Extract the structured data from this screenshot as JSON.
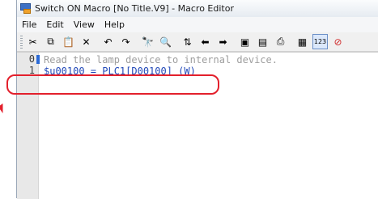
{
  "window": {
    "title": "Switch ON Macro [No Title.V9] - Macro Editor"
  },
  "menu": [
    {
      "label": "File"
    },
    {
      "label": "Edit"
    },
    {
      "label": "View"
    },
    {
      "label": "Help"
    }
  ],
  "toolbar": {
    "buttons": [
      {
        "name": "cut-icon",
        "glyph": "✂"
      },
      {
        "name": "copy-icon",
        "glyph": "⧉"
      },
      {
        "name": "paste-icon",
        "glyph": "📋"
      },
      {
        "name": "delete-icon",
        "glyph": "✕"
      },
      {
        "name": "undo-icon",
        "glyph": "↶"
      },
      {
        "name": "redo-icon",
        "glyph": "↷"
      },
      {
        "name": "find-icon",
        "glyph": "🔭"
      },
      {
        "name": "replace-icon",
        "glyph": "🔍"
      },
      {
        "name": "go-to-icon",
        "glyph": "⇅"
      },
      {
        "name": "back-icon",
        "glyph": "⬅"
      },
      {
        "name": "forward-icon",
        "glyph": "➡"
      },
      {
        "name": "register-icon",
        "glyph": "▣"
      },
      {
        "name": "check-icon",
        "glyph": "▤"
      },
      {
        "name": "print-icon",
        "glyph": "⎙"
      },
      {
        "name": "layout-icon",
        "glyph": "▦"
      },
      {
        "name": "line-number-icon",
        "glyph": "123",
        "active": true
      },
      {
        "name": "stop-icon",
        "glyph": "⊘"
      }
    ]
  },
  "editor": {
    "lines": [
      {
        "number": "0",
        "text": "Read the lamp device to internal device.",
        "kind": "comment"
      },
      {
        "number": "1",
        "text": "$u00100 = PLC1[D00100] (W)",
        "kind": "code"
      }
    ]
  },
  "colors": {
    "highlight": "#e3202c",
    "code": "#2148b8",
    "comment": "#9e9e9e",
    "caret": "#2a6ad6"
  }
}
